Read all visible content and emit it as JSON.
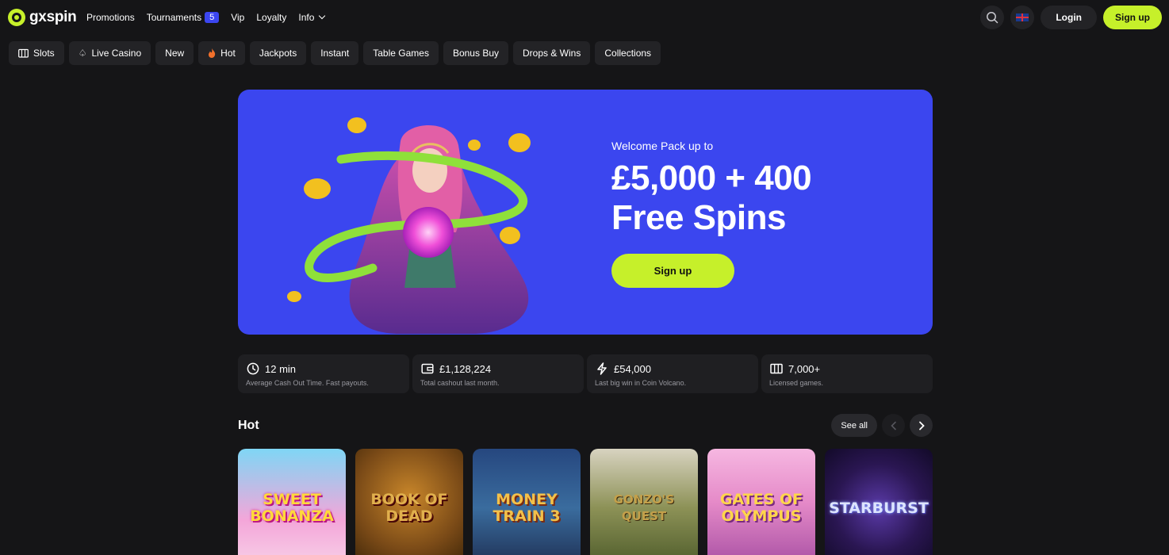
{
  "brand": {
    "name": "gxspin",
    "accent": "#c6f02a",
    "hero_bg": "#3b46ef"
  },
  "nav": {
    "promotions": "Promotions",
    "tournaments": "Tournaments",
    "tournaments_count": "5",
    "vip": "Vip",
    "loyalty": "Loyalty",
    "info": "Info"
  },
  "header_actions": {
    "search_icon": "search-icon",
    "language_icon": "uk-flag-icon",
    "login": "Login",
    "signup": "Sign up"
  },
  "categories": [
    {
      "label": "Slots",
      "icon": "slot-machine-icon"
    },
    {
      "label": "Live Casino",
      "icon": "spade-icon"
    },
    {
      "label": "New",
      "icon": ""
    },
    {
      "label": "Hot",
      "icon": "flame-icon"
    },
    {
      "label": "Jackpots",
      "icon": ""
    },
    {
      "label": "Instant",
      "icon": ""
    },
    {
      "label": "Table Games",
      "icon": ""
    },
    {
      "label": "Bonus Buy",
      "icon": ""
    },
    {
      "label": "Drops & Wins",
      "icon": ""
    },
    {
      "label": "Collections",
      "icon": ""
    }
  ],
  "hero": {
    "subtitle": "Welcome Pack up to",
    "title_line1": "£5,000 + 400",
    "title_line2": "Free Spins",
    "cta": "Sign up"
  },
  "stats": [
    {
      "value": "12 min",
      "desc": "Average Cash Out Time. Fast payouts.",
      "icon": "clock-icon"
    },
    {
      "value": "£1,128,224",
      "desc": "Total cashout last month.",
      "icon": "wallet-icon"
    },
    {
      "value": "£54,000",
      "desc": "Last big win in Coin Volcano.",
      "icon": "lightning-icon"
    },
    {
      "value": "7,000+",
      "desc": "Licensed games.",
      "icon": "slot-machine-icon"
    }
  ],
  "hot": {
    "title": "Hot",
    "see_all": "See all",
    "games": [
      {
        "name": "Sweet Bonanza"
      },
      {
        "name": "Book of Dead"
      },
      {
        "name": "Money Train 3"
      },
      {
        "name": "Gonzo's Quest"
      },
      {
        "name": "Gates of Olympus"
      },
      {
        "name": "Starburst"
      }
    ]
  }
}
